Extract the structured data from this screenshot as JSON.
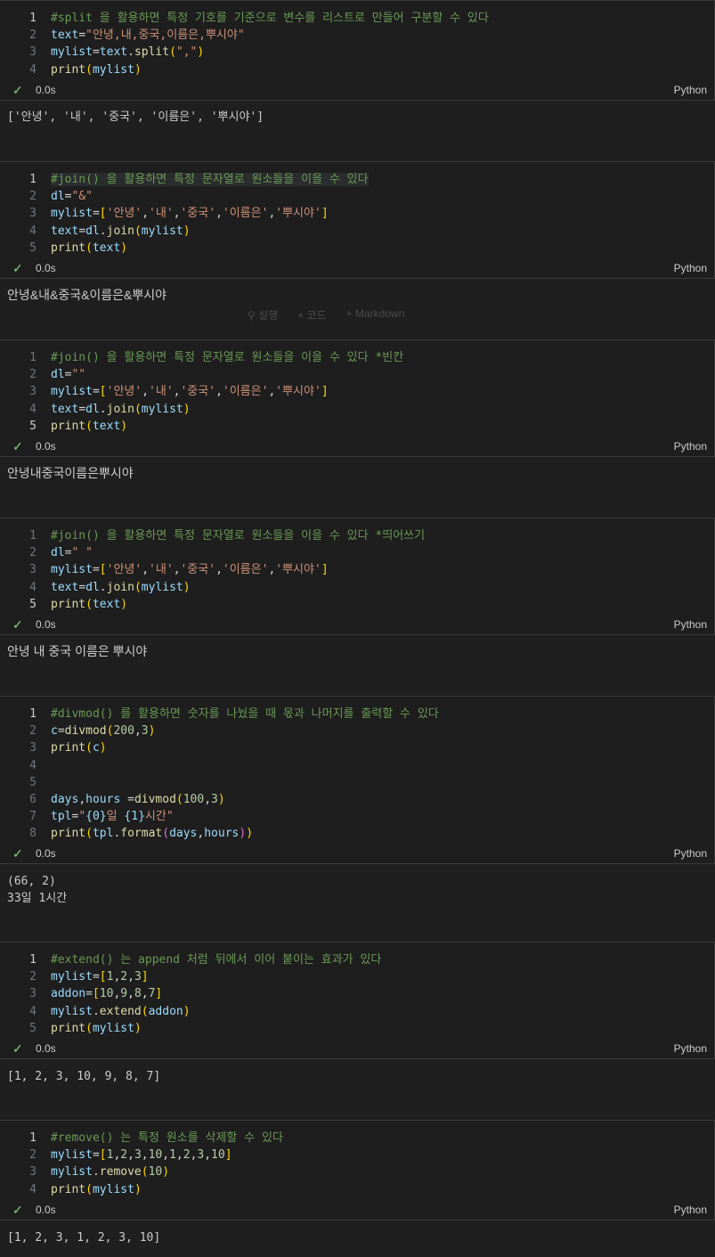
{
  "cells": [
    {
      "lines": [
        [
          [
            "c-comment",
            "#split 을 활용하면 특정 기호를 기준으로 변수를 리스트로 만들어 구분할 수 있다"
          ]
        ],
        [
          [
            "c-var",
            "text"
          ],
          [
            "c-op",
            "="
          ],
          [
            "c-str",
            "\"안녕,내,중국,이름은,뿌시야\""
          ]
        ],
        [
          [
            "c-var",
            "mylist"
          ],
          [
            "c-op",
            "="
          ],
          [
            "c-var",
            "text"
          ],
          [
            "c-op",
            "."
          ],
          [
            "c-fn",
            "split"
          ],
          [
            "c-br1",
            "("
          ],
          [
            "c-str",
            "\",\""
          ],
          [
            "c-br1",
            ")"
          ]
        ],
        [
          [
            "c-fn",
            "print"
          ],
          [
            "c-br1",
            "("
          ],
          [
            "c-var",
            "mylist"
          ],
          [
            "c-br1",
            ")"
          ]
        ]
      ],
      "active_line": 1,
      "duration": "0.0s",
      "language": "Python",
      "output": [
        "['안녕', '내', '중국', '이름은', '뿌시야']"
      ]
    },
    {
      "lines": [
        [
          [
            "c-comment",
            "#join() 을 활용하면 특정 문자열로 원소들을 이을 수 있다"
          ]
        ],
        [
          [
            "c-var",
            "dl"
          ],
          [
            "c-op",
            "="
          ],
          [
            "c-str",
            "\"&\""
          ]
        ],
        [
          [
            "c-var",
            "mylist"
          ],
          [
            "c-op",
            "="
          ],
          [
            "c-br1",
            "["
          ],
          [
            "c-str",
            "'안녕'"
          ],
          [
            "c-op",
            ","
          ],
          [
            "c-str",
            "'내'"
          ],
          [
            "c-op",
            ","
          ],
          [
            "c-str",
            "'중국'"
          ],
          [
            "c-op",
            ","
          ],
          [
            "c-str",
            "'이름은'"
          ],
          [
            "c-op",
            ","
          ],
          [
            "c-str",
            "'뿌시야'"
          ],
          [
            "c-br1",
            "]"
          ]
        ],
        [
          [
            "c-var",
            "text"
          ],
          [
            "c-op",
            "="
          ],
          [
            "c-var",
            "dl"
          ],
          [
            "c-op",
            "."
          ],
          [
            "c-fn",
            "join"
          ],
          [
            "c-br1",
            "("
          ],
          [
            "c-var",
            "mylist"
          ],
          [
            "c-br1",
            ")"
          ]
        ],
        [
          [
            "c-fn",
            "print"
          ],
          [
            "c-br1",
            "("
          ],
          [
            "c-var",
            "text"
          ],
          [
            "c-br1",
            ")"
          ]
        ]
      ],
      "active_line": 1,
      "duration": "0.0s",
      "language": "Python",
      "output": [
        "안녕&내&중국&이름은&뿌시야"
      ]
    },
    {
      "lines": [
        [
          [
            "c-comment",
            "#join() 을 활용하면 특정 문자열로 원소들을 이을 수 있다 *빈칸"
          ]
        ],
        [
          [
            "c-var",
            "dl"
          ],
          [
            "c-op",
            "="
          ],
          [
            "c-str",
            "\"\""
          ]
        ],
        [
          [
            "c-var",
            "mylist"
          ],
          [
            "c-op",
            "="
          ],
          [
            "c-br1",
            "["
          ],
          [
            "c-str",
            "'안녕'"
          ],
          [
            "c-op",
            ","
          ],
          [
            "c-str",
            "'내'"
          ],
          [
            "c-op",
            ","
          ],
          [
            "c-str",
            "'중국'"
          ],
          [
            "c-op",
            ","
          ],
          [
            "c-str",
            "'이름은'"
          ],
          [
            "c-op",
            ","
          ],
          [
            "c-str",
            "'뿌시야'"
          ],
          [
            "c-br1",
            "]"
          ]
        ],
        [
          [
            "c-var",
            "text"
          ],
          [
            "c-op",
            "="
          ],
          [
            "c-var",
            "dl"
          ],
          [
            "c-op",
            "."
          ],
          [
            "c-fn",
            "join"
          ],
          [
            "c-br1",
            "("
          ],
          [
            "c-var",
            "mylist"
          ],
          [
            "c-br1",
            ")"
          ]
        ],
        [
          [
            "c-fn",
            "print"
          ],
          [
            "c-br1",
            "("
          ],
          [
            "c-var",
            "text"
          ],
          [
            "c-br1",
            ")"
          ]
        ]
      ],
      "active_line": 5,
      "duration": "0.0s",
      "language": "Python",
      "output": [
        "안녕내중국이름은뿌시야"
      ]
    },
    {
      "lines": [
        [
          [
            "c-comment",
            "#join() 을 활용하면 특정 문자열로 원소들을 이을 수 있다 *띄어쓰기"
          ]
        ],
        [
          [
            "c-var",
            "dl"
          ],
          [
            "c-op",
            "="
          ],
          [
            "c-str",
            "\" \""
          ]
        ],
        [
          [
            "c-var",
            "mylist"
          ],
          [
            "c-op",
            "="
          ],
          [
            "c-br1",
            "["
          ],
          [
            "c-str",
            "'안녕'"
          ],
          [
            "c-op",
            ","
          ],
          [
            "c-str",
            "'내'"
          ],
          [
            "c-op",
            ","
          ],
          [
            "c-str",
            "'중국'"
          ],
          [
            "c-op",
            ","
          ],
          [
            "c-str",
            "'이름은'"
          ],
          [
            "c-op",
            ","
          ],
          [
            "c-str",
            "'뿌시야'"
          ],
          [
            "c-br1",
            "]"
          ]
        ],
        [
          [
            "c-var",
            "text"
          ],
          [
            "c-op",
            "="
          ],
          [
            "c-var",
            "dl"
          ],
          [
            "c-op",
            "."
          ],
          [
            "c-fn",
            "join"
          ],
          [
            "c-br1",
            "("
          ],
          [
            "c-var",
            "mylist"
          ],
          [
            "c-br1",
            ")"
          ]
        ],
        [
          [
            "c-fn",
            "print"
          ],
          [
            "c-br1",
            "("
          ],
          [
            "c-var",
            "text"
          ],
          [
            "c-br1",
            ")"
          ]
        ]
      ],
      "active_line": 5,
      "duration": "0.0s",
      "language": "Python",
      "output": [
        "안녕 내 중국 이름은 뿌시야"
      ]
    },
    {
      "lines": [
        [
          [
            "c-comment",
            "#divmod() 를 활용하면 숫자를 나눴을 때 몫과 나머지를 출력할 수 있다"
          ]
        ],
        [
          [
            "c-var",
            "c"
          ],
          [
            "c-op",
            "="
          ],
          [
            "c-fn",
            "divmod"
          ],
          [
            "c-br1",
            "("
          ],
          [
            "c-num",
            "200"
          ],
          [
            "c-op",
            ","
          ],
          [
            "c-num",
            "3"
          ],
          [
            "c-br1",
            ")"
          ]
        ],
        [
          [
            "c-fn",
            "print"
          ],
          [
            "c-br1",
            "("
          ],
          [
            "c-var",
            "c"
          ],
          [
            "c-br1",
            ")"
          ]
        ],
        [],
        [],
        [
          [
            "c-var",
            "days"
          ],
          [
            "c-op",
            ","
          ],
          [
            "c-var",
            "hours"
          ],
          [
            "c-op",
            " ="
          ],
          [
            "c-fn",
            "divmod"
          ],
          [
            "c-br1",
            "("
          ],
          [
            "c-num",
            "100"
          ],
          [
            "c-op",
            ","
          ],
          [
            "c-num",
            "3"
          ],
          [
            "c-br1",
            ")"
          ]
        ],
        [
          [
            "c-var",
            "tpl"
          ],
          [
            "c-op",
            "="
          ],
          [
            "c-str",
            "\""
          ],
          [
            "c-var",
            "{0}"
          ],
          [
            "c-str",
            "일 "
          ],
          [
            "c-var",
            "{1}"
          ],
          [
            "c-str",
            "시간\""
          ]
        ],
        [
          [
            "c-fn",
            "print"
          ],
          [
            "c-br1",
            "("
          ],
          [
            "c-var",
            "tpl"
          ],
          [
            "c-op",
            "."
          ],
          [
            "c-fn",
            "format"
          ],
          [
            "c-br2",
            "("
          ],
          [
            "c-var",
            "days"
          ],
          [
            "c-op",
            ","
          ],
          [
            "c-var",
            "hours"
          ],
          [
            "c-br2",
            ")"
          ],
          [
            "c-br1",
            ")"
          ]
        ]
      ],
      "active_line": 1,
      "duration": "0.0s",
      "language": "Python",
      "output": [
        "(66, 2)",
        "33일 1시간"
      ]
    },
    {
      "lines": [
        [
          [
            "c-comment",
            "#extend() 는 append 처럼 뒤에서 이어 붙이는 효과가 있다"
          ]
        ],
        [
          [
            "c-var",
            "mylist"
          ],
          [
            "c-op",
            "="
          ],
          [
            "c-br1",
            "["
          ],
          [
            "c-num",
            "1"
          ],
          [
            "c-op",
            ","
          ],
          [
            "c-num",
            "2"
          ],
          [
            "c-op",
            ","
          ],
          [
            "c-num",
            "3"
          ],
          [
            "c-br1",
            "]"
          ]
        ],
        [
          [
            "c-var",
            "addon"
          ],
          [
            "c-op",
            "="
          ],
          [
            "c-br1",
            "["
          ],
          [
            "c-num",
            "10"
          ],
          [
            "c-op",
            ","
          ],
          [
            "c-num",
            "9"
          ],
          [
            "c-op",
            ","
          ],
          [
            "c-num",
            "8"
          ],
          [
            "c-op",
            ","
          ],
          [
            "c-num",
            "7"
          ],
          [
            "c-br1",
            "]"
          ]
        ],
        [
          [
            "c-var",
            "mylist"
          ],
          [
            "c-op",
            "."
          ],
          [
            "c-fn",
            "extend"
          ],
          [
            "c-br1",
            "("
          ],
          [
            "c-var",
            "addon"
          ],
          [
            "c-br1",
            ")"
          ]
        ],
        [
          [
            "c-fn",
            "print"
          ],
          [
            "c-br1",
            "("
          ],
          [
            "c-var",
            "mylist"
          ],
          [
            "c-br1",
            ")"
          ]
        ]
      ],
      "active_line": 1,
      "duration": "0.0s",
      "language": "Python",
      "output": [
        "[1, 2, 3, 10, 9, 8, 7]"
      ]
    },
    {
      "lines": [
        [
          [
            "c-comment",
            "#remove() 는 특정 원소를 삭제할 수 있다"
          ]
        ],
        [
          [
            "c-var",
            "mylist"
          ],
          [
            "c-op",
            "="
          ],
          [
            "c-br1",
            "["
          ],
          [
            "c-num",
            "1"
          ],
          [
            "c-op",
            ","
          ],
          [
            "c-num",
            "2"
          ],
          [
            "c-op",
            ","
          ],
          [
            "c-num",
            "3"
          ],
          [
            "c-op",
            ","
          ],
          [
            "c-num",
            "10"
          ],
          [
            "c-op",
            ","
          ],
          [
            "c-num",
            "1"
          ],
          [
            "c-op",
            ","
          ],
          [
            "c-num",
            "2"
          ],
          [
            "c-op",
            ","
          ],
          [
            "c-num",
            "3"
          ],
          [
            "c-op",
            ","
          ],
          [
            "c-num",
            "10"
          ],
          [
            "c-br1",
            "]"
          ]
        ],
        [
          [
            "c-var",
            "mylist"
          ],
          [
            "c-op",
            "."
          ],
          [
            "c-fn",
            "remove"
          ],
          [
            "c-br1",
            "("
          ],
          [
            "c-num",
            "10"
          ],
          [
            "c-br1",
            ")"
          ]
        ],
        [
          [
            "c-fn",
            "print"
          ],
          [
            "c-br1",
            "("
          ],
          [
            "c-var",
            "mylist"
          ],
          [
            "c-br1",
            ")"
          ]
        ]
      ],
      "active_line": 1,
      "duration": "0.0s",
      "language": "Python",
      "output": [
        "[1, 2, 3, 1, 2, 3, 10]"
      ]
    }
  ],
  "toolbar": {
    "run_label": "⚲ 실행",
    "code_label": "+ 코드",
    "markdown_label": "+ Markdown"
  }
}
